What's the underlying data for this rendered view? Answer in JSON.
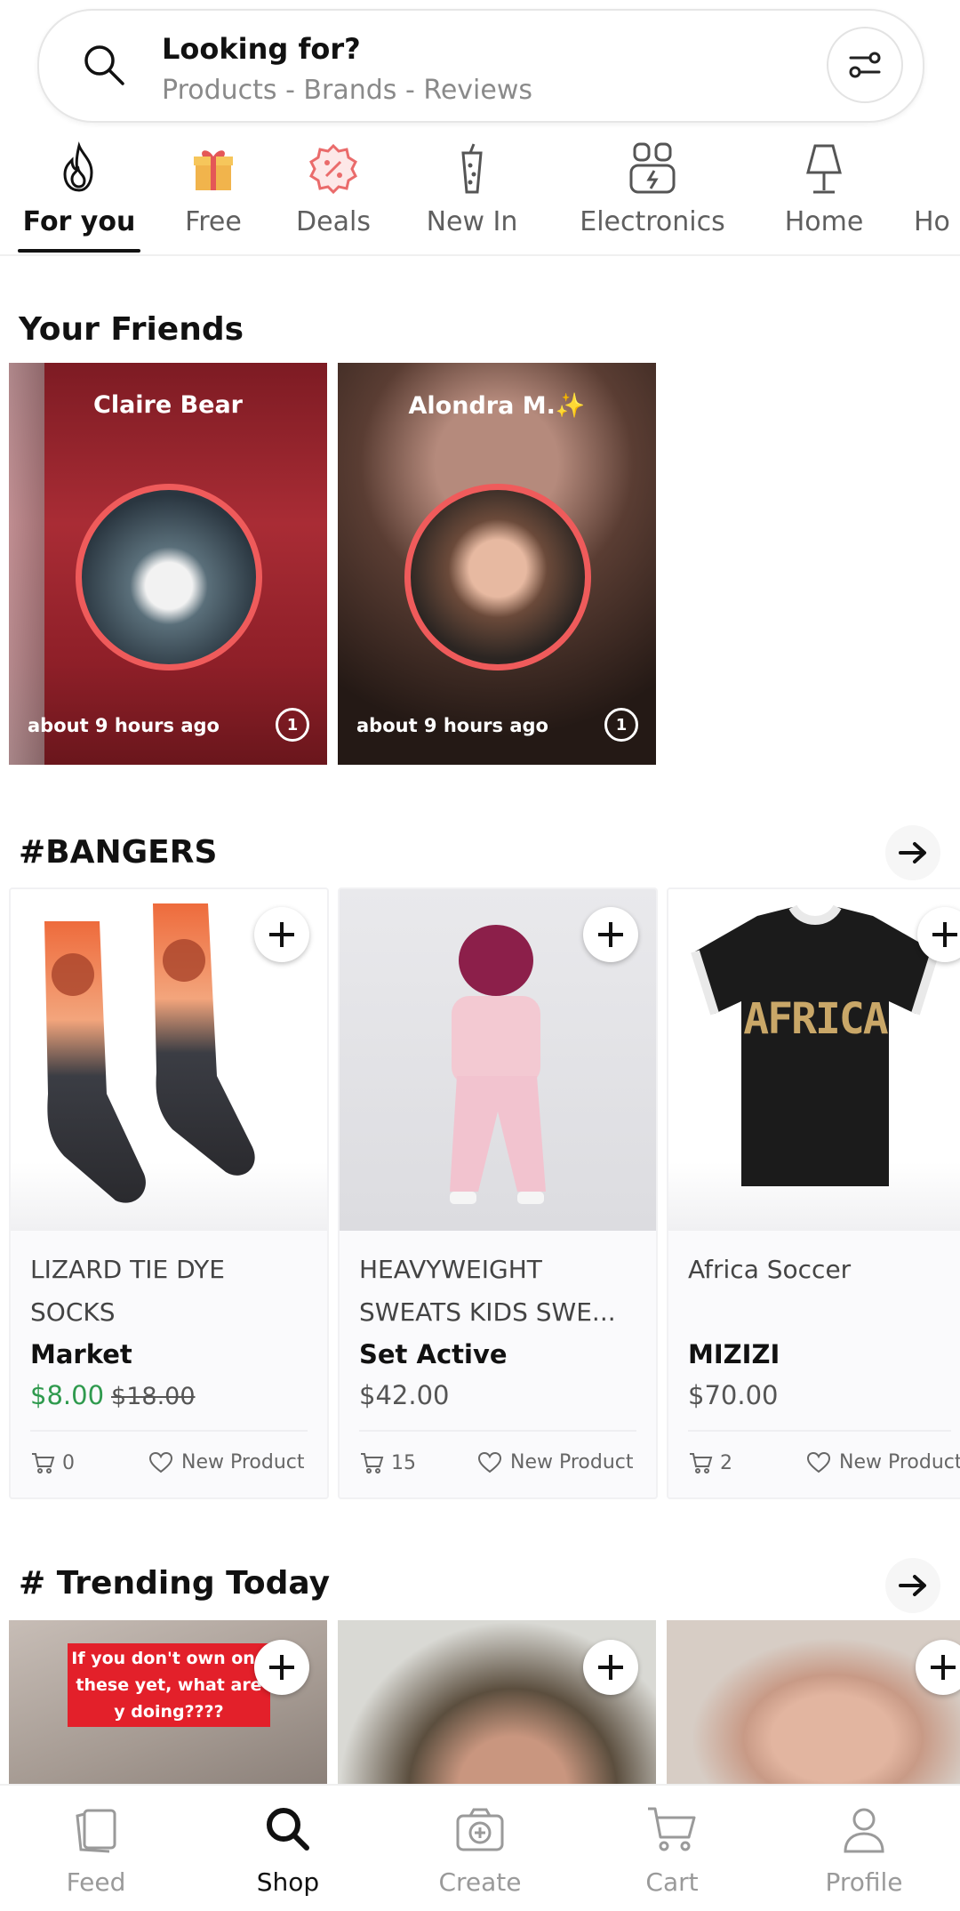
{
  "search": {
    "title": "Looking for?",
    "placeholder": "Products - Brands - Reviews"
  },
  "categories": [
    {
      "label": "For you",
      "icon": "flame-icon",
      "active": true
    },
    {
      "label": "Free",
      "icon": "gift-icon"
    },
    {
      "label": "Deals",
      "icon": "percent-badge-icon"
    },
    {
      "label": "New In",
      "icon": "drink-icon"
    },
    {
      "label": "Electronics",
      "icon": "earbuds-icon"
    },
    {
      "label": "Home",
      "icon": "lamp-icon"
    },
    {
      "label": "Ho",
      "icon": ""
    }
  ],
  "friends": {
    "title": "Your Friends",
    "items": [
      {
        "name": "Claire Bear",
        "time": "about 9 hours ago",
        "count": "1"
      },
      {
        "name": "Alondra M.✨",
        "time": "about 9 hours ago",
        "count": "1"
      }
    ]
  },
  "bangers": {
    "title": "#BANGERS",
    "products": [
      {
        "name": "LIZARD TIE DYE SOCKS",
        "brand": "Market",
        "price": "$8.00",
        "old_price": "$18.00",
        "cart_count": "0",
        "status": "New Product"
      },
      {
        "name": "HEAVYWEIGHT SWEATS KIDS SWE...",
        "brand": "Set Active",
        "price": "$42.00",
        "cart_count": "15",
        "status": "New Product"
      },
      {
        "name": "Africa Soccer",
        "brand": "MIZIZI",
        "price": "$70.00",
        "cart_count": "2",
        "status": "New Product"
      }
    ],
    "jersey_text": "AFRICA"
  },
  "trending": {
    "title": "# Trending Today",
    "caption": "If you don't own one these yet, what are y doing????"
  },
  "nav": [
    {
      "label": "Feed",
      "icon": "feed-icon"
    },
    {
      "label": "Shop",
      "icon": "search-icon",
      "active": true
    },
    {
      "label": "Create",
      "icon": "camera-icon"
    },
    {
      "label": "Cart",
      "icon": "cart-icon"
    },
    {
      "label": "Profile",
      "icon": "profile-icon"
    }
  ],
  "colors": {
    "accent_ring": "#ef5b5b",
    "sale_green": "#2f9a4e"
  }
}
